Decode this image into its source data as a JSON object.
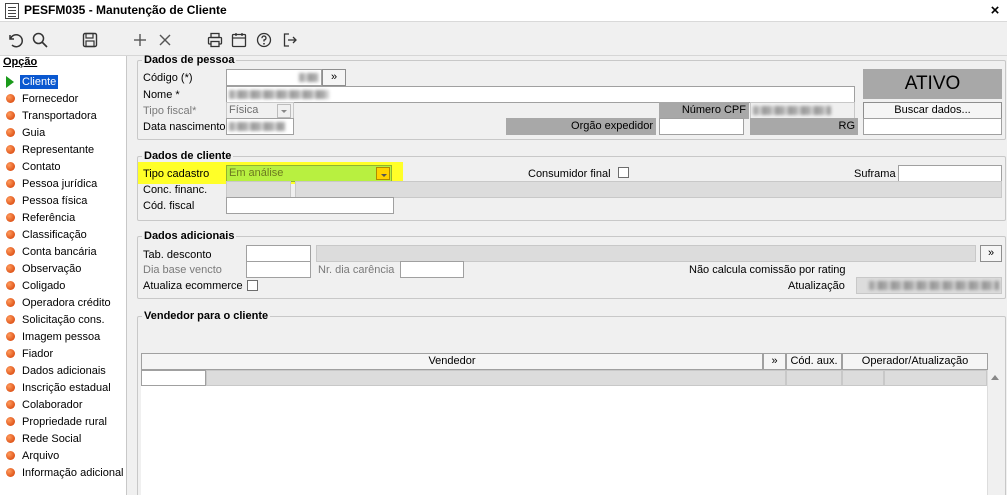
{
  "window": {
    "title": "PESFM035 - Manutenção de Cliente",
    "close_label": "×"
  },
  "toolbar": {
    "icons": [
      "undo-icon",
      "search-icon",
      "save-icon",
      "add-icon",
      "delete-icon",
      "print-icon",
      "calendar-icon",
      "help-icon",
      "exit-icon"
    ]
  },
  "sidebar": {
    "header": "Opção",
    "items": [
      {
        "label": "Cliente",
        "selected": true
      },
      {
        "label": "Fornecedor"
      },
      {
        "label": "Transportadora"
      },
      {
        "label": "Guia"
      },
      {
        "label": "Representante"
      },
      {
        "label": "Contato"
      },
      {
        "label": "Pessoa jurídica"
      },
      {
        "label": "Pessoa física"
      },
      {
        "label": "Referência"
      },
      {
        "label": "Classificação"
      },
      {
        "label": "Conta bancária"
      },
      {
        "label": "Observação"
      },
      {
        "label": "Coligado"
      },
      {
        "label": "Operadora crédito"
      },
      {
        "label": "Solicitação cons."
      },
      {
        "label": "Imagem pessoa"
      },
      {
        "label": "Fiador"
      },
      {
        "label": "Dados adicionais"
      },
      {
        "label": "Inscrição estadual"
      },
      {
        "label": "Colaborador"
      },
      {
        "label": "Propriedade rural"
      },
      {
        "label": "Rede Social"
      },
      {
        "label": "Arquivo"
      },
      {
        "label": "Informação adicional"
      }
    ]
  },
  "dados_pessoa": {
    "legend": "Dados de pessoa",
    "codigo_label": "Código (*)",
    "nome_label": "Nome *",
    "tipo_fiscal_label": "Tipo fiscal*",
    "tipo_fiscal_value": "Física",
    "data_nasc_label": "Data nascimento",
    "numero_cpf_label": "Número CPF",
    "orgao_label": "Orgão expedidor",
    "rg_label": "RG",
    "status": "ATIVO",
    "buscar_label": "Buscar dados...",
    "lookup_label": "»"
  },
  "dados_cliente": {
    "legend": "Dados de cliente",
    "tipo_cadastro_label": "Tipo cadastro",
    "tipo_cadastro_value": "Em análise",
    "consumidor_label": "Consumidor final",
    "suframa_label": "Suframa",
    "conc_label": "Conc. financ.",
    "cod_fiscal_label": "Cód. fiscal"
  },
  "dados_adicionais": {
    "legend": "Dados adicionais",
    "tab_desconto_label": "Tab. desconto",
    "dia_base_label": "Dia base vencto",
    "nr_dia_label": "Nr. dia carência",
    "nao_calcula_label": "Não calcula comissão por rating",
    "atualiza_label": "Atualiza ecommerce",
    "atualizacao_label": "Atualização",
    "lookup_label": "»"
  },
  "vendedor": {
    "legend": "Vendedor para o cliente",
    "columns": [
      "Vendedor",
      "»",
      "Cód. aux.",
      "Operador/Atualização"
    ]
  }
}
